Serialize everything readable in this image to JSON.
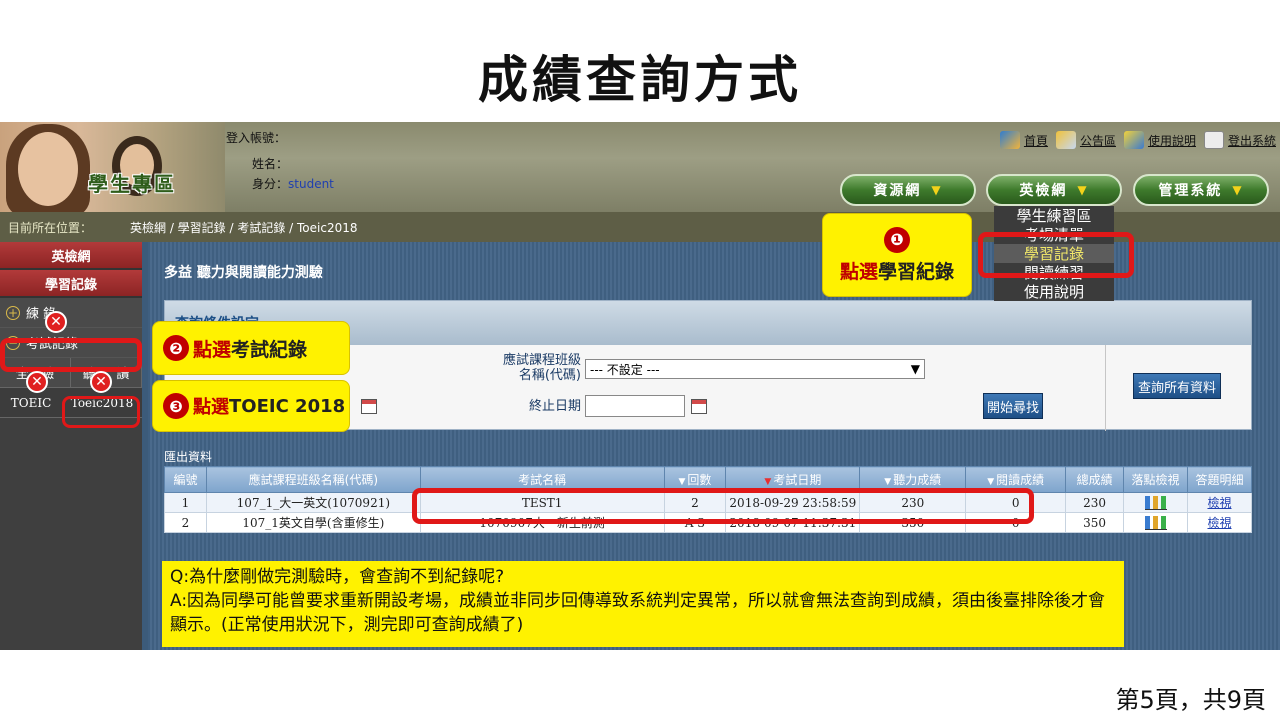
{
  "slide": {
    "title": "成績查詢方式",
    "page_number": "第5頁，共9頁"
  },
  "header": {
    "brand": "學生專區",
    "login": {
      "account_label": "登入帳號：",
      "account_value": "",
      "name_label": "姓名：",
      "name_value": "",
      "role_label": "身分：",
      "role_value": "student"
    },
    "top_links": [
      "首頁",
      "公告區",
      "使用說明",
      "登出系統"
    ],
    "nav": [
      "資源網",
      "英檢網",
      "管理系統"
    ]
  },
  "breadcrumb": {
    "label": "目前所在位置：",
    "path": "英檢網 / 學習記錄 / 考試記錄 / Toeic2018"
  },
  "sidebar": {
    "section1": "英檢網",
    "section2": "學習記錄",
    "practice": "練習記錄",
    "practice_visible": "練  錄",
    "exam": "考試記錄",
    "sub_all": "全",
    "sub_listen": "聽",
    "sub_read": "讀",
    "sub_mid": "驗",
    "test1": "TOEIC",
    "test2": "Toeic2018"
  },
  "dropdown": {
    "items": [
      "學生練習區",
      "考場清單",
      "學習記錄",
      "閱讀練習",
      "使用說明"
    ]
  },
  "main": {
    "title": "多益 聽力與閱讀能力測驗",
    "query": {
      "header": "查詢條件設定",
      "class_label_line1": "應試課程班級",
      "class_label_line2": "名稱(代碼)",
      "class_value": "--- 不設定 ---",
      "end_date_label": "終止日期",
      "search_button": "開始尋找",
      "all_button": "查詢所有資料"
    },
    "export_label": "匯出資料",
    "table": {
      "headers": [
        "編號",
        "應試課程班級名稱(代碼)",
        "考試名稱",
        "回數",
        "考試日期",
        "聽力成績",
        "閱讀成績",
        "總成績",
        "落點檢視",
        "答題明細"
      ],
      "rows": [
        [
          "1",
          "107_1_大一英文(1070921)",
          "TEST1",
          "2",
          "2018-09-29 23:58:59",
          "230",
          "0",
          "230",
          "",
          "檢視"
        ],
        [
          "2",
          "107_1英文自學(含重修生)",
          "1070907大一新生前測",
          "A 3",
          "2018-09-07 11:37:31",
          "350",
          "0",
          "350",
          "",
          "檢視"
        ]
      ]
    }
  },
  "callouts": {
    "c1_num": "❶",
    "c1_pre": "點選",
    "c1_text": "學習紀錄",
    "c2_num": "❷",
    "c2_pre": "點選",
    "c2_text": "考試紀錄",
    "c3_num": "❸",
    "c3_pre": "點選",
    "c3_text": "TOEIC 2018"
  },
  "qa": {
    "q": "Q:為什麼剛做完測驗時，會查詢不到紀錄呢?",
    "a": "A:因為同學可能曾要求重新開設考場，成績並非同步回傳導致系統判定異常，所以就會無法查詢到成績，須由後臺排除後才會顯示。(正常使用狀況下，測完即可查詢成績了)"
  },
  "colors": {
    "highlight": "#e01818",
    "callout_bg": "#fff200",
    "nav_green": "#3e7a2c",
    "main_bg": "#3f5f80"
  }
}
